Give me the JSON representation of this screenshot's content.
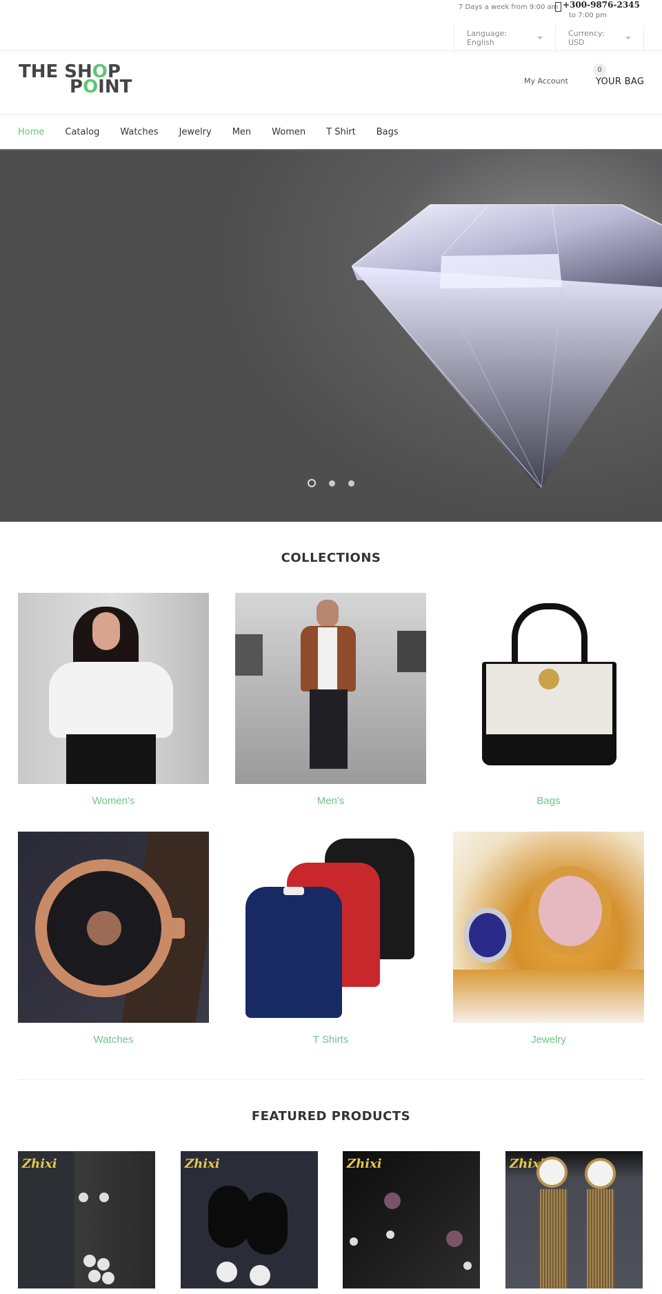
{
  "topbar": {
    "hours_line1": "7 Days a week from 9:00 am",
    "phone_icon": "phone-icon",
    "phone": "+300-9876-2345",
    "hours_line2": "to 7:00 pm",
    "language_label": "Language: English",
    "currency_label": "Currency: USD"
  },
  "header": {
    "logo_line1_a": "THE SH",
    "logo_line1_b": "O",
    "logo_line1_c": "P",
    "logo_line2_a": "P",
    "logo_line2_b": "O",
    "logo_line2_c": "INT",
    "account_label": "My Account",
    "bag_count": "0",
    "bag_label": "YOUR BAG",
    "brand_color": "#5dc777"
  },
  "nav": {
    "items": [
      {
        "label": "Home",
        "active": true
      },
      {
        "label": "Catalog"
      },
      {
        "label": "Watches"
      },
      {
        "label": "Jewelry"
      },
      {
        "label": "Men"
      },
      {
        "label": "Women"
      },
      {
        "label": "T Shirt"
      },
      {
        "label": "Bags"
      }
    ]
  },
  "hero": {
    "image": "diamond-image",
    "slides_total": 3,
    "active_slide": 1
  },
  "collections": {
    "title": "COLLECTIONS",
    "items": [
      {
        "label": "Women's",
        "image": "woman-lace-top-image"
      },
      {
        "label": "Men's",
        "image": "man-brown-jacket-image"
      },
      {
        "label": "Bags",
        "image": "white-black-handbag-image"
      },
      {
        "label": "Watches",
        "image": "rose-gold-watch-image"
      },
      {
        "label": "T Shirts",
        "image": "polo-shirts-image"
      },
      {
        "label": "Jewelry",
        "image": "gold-rings-image"
      }
    ]
  },
  "featured": {
    "title": "FEATURED PRODUCTS",
    "brand_watermark": "Zhixi",
    "items": [
      {
        "image": "pearl-drop-earrings-image"
      },
      {
        "image": "black-lace-pearl-earrings-image"
      },
      {
        "image": "purple-pearl-bar-earrings-image"
      },
      {
        "image": "baroque-pearl-tassel-earrings-image"
      }
    ]
  }
}
